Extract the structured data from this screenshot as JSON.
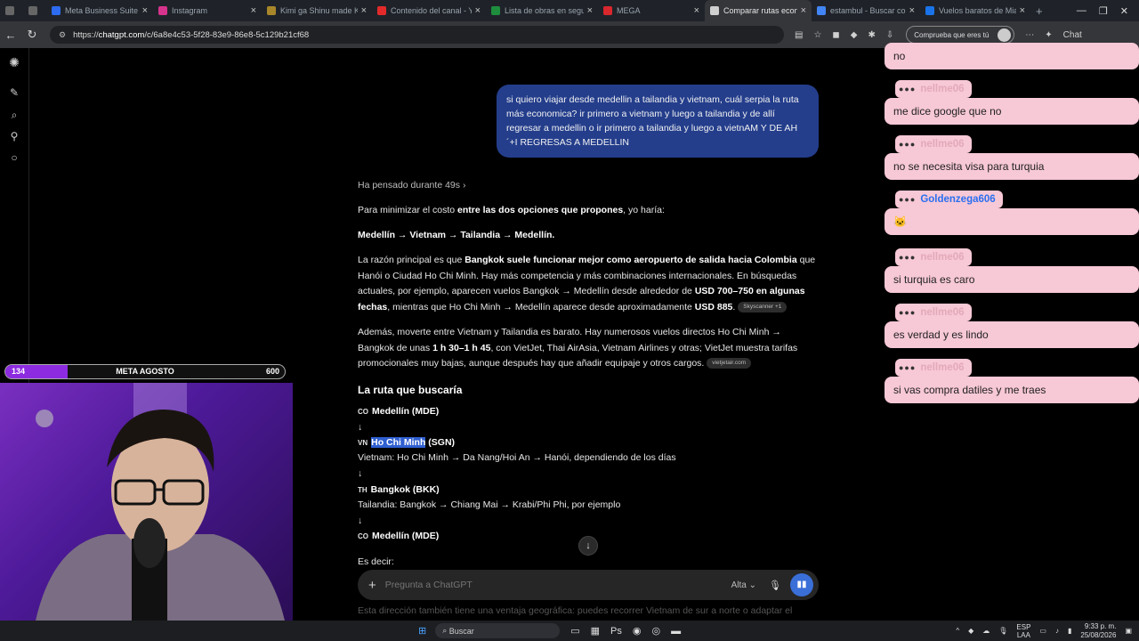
{
  "tabs": [
    {
      "label": "Meta Business Suite",
      "color": "#2d6bf0",
      "active": false
    },
    {
      "label": "Instagram",
      "color": "#d6338d",
      "active": false
    },
    {
      "label": "Kimi ga Shinu made Koi",
      "color": "#a8862a",
      "active": false
    },
    {
      "label": "Contenido del canal - Y",
      "color": "#e22a2a",
      "active": false
    },
    {
      "label": "Lista de obras en segu",
      "color": "#1e8e3e",
      "active": false
    },
    {
      "label": "MEGA",
      "color": "#d9272e",
      "active": false
    },
    {
      "label": "Comparar rutas económ",
      "color": "#cfcfcf",
      "active": true
    },
    {
      "label": "estambul - Buscar con",
      "color": "#4285f4",
      "active": false
    },
    {
      "label": "Vuelos baratos de Mia",
      "color": "#1a73e8",
      "active": false
    }
  ],
  "address": {
    "protocol": "https://",
    "host": "chatgpt.com",
    "path": "/c/6a8e4c53-5f28-83e9-86e8-5c129b21cf68"
  },
  "captcha_label": "Comprueba que eres tú",
  "chat_label": "Chat",
  "user_message": "si quiero viajar desde medellin a tailandia y vietnam, cuál serpia la ruta más economica? ir primero a vietnam y luego a tailandia y de allí regresar a medellin o ir primero a tailandia y luego a vietnAM Y DE AH ´+I REGRESAS A MEDELLIN",
  "thought": "Ha pensado durante 49s",
  "p1_a": "Para minimizar el costo ",
  "p1_b": "entre las dos opciones que propones",
  "p1_c": ", yo haría:",
  "p2": "Medellín → Vietnam → Tailandia → Medellín.",
  "p3_a": "La razón principal es que ",
  "p3_b": "Bangkok suele funcionar mejor como aeropuerto de salida hacia Colombia",
  "p3_c": " que Hanói o Ciudad Ho Chi Minh. Hay más competencia y más combinaciones internacionales. En búsquedas actuales, por ejemplo, aparecen vuelos Bangkok → Medellín desde alrededor de ",
  "p3_d": "USD 700–750 en algunas fechas",
  "p3_e": ", mientras que Ho Chi Minh → Medellín aparece desde aproximadamente ",
  "p3_f": "USD 885",
  "p3_g": ".",
  "src1": "Skyscanner +1",
  "p4_a": "Además, moverte entre Vietnam y Tailandia es barato. Hay numerosos vuelos directos Ho Chi Minh → Bangkok de unas ",
  "p4_b": "1 h 30–1 h 45",
  "p4_c": ", con VietJet, Thai AirAsia, Vietnam Airlines y otras; VietJet muestra tarifas promocionales muy bajas, aunque después hay que añadir equipaje y otros cargos.",
  "src2": "vietjetair.com",
  "heading": "La ruta que buscaría",
  "arrow": "↓",
  "r1_flag": "CO",
  "r1": "Medellín (MDE)",
  "r2_flag": "VN",
  "r2_hl": "Ho Chi Minh",
  "r2_rest": " (SGN)",
  "r2_desc": "Vietnam: Ho Chi Minh → Da Nang/Hoi An → Hanói, dependiendo de los días",
  "r3_flag": "TH",
  "r3": "Bangkok (BKK)",
  "r3_desc": "Tailandia: Bangkok → Chiang Mai → Krabi/Phi Phi, por ejemplo",
  "r4_flag": "CO",
  "r4": "Medellín (MDE)",
  "es_decir": "Es decir:",
  "composer_placeholder": "Pregunta a ChatGPT",
  "model": "Alta",
  "fade_text": "Esta dirección también tiene una ventaja geográfica: puedes recorrer Vietnam de sur a norte o adaptar el",
  "live_chat": [
    {
      "user": "",
      "msg": "no"
    },
    {
      "user": "nellme06",
      "msg": "me dice google que no"
    },
    {
      "user": "nellme06",
      "msg": "no se necesita visa para turquia"
    },
    {
      "user": "Goldenzega606",
      "msg": "🐱"
    },
    {
      "user": "nellme06",
      "msg": "si turquia es caro"
    },
    {
      "user": "nellme06",
      "msg": "es verdad y es lindo"
    },
    {
      "user": "nellme06",
      "msg": "si vas compra datiles y me traes"
    }
  ],
  "meta": {
    "label": "META AGOSTO",
    "current": "134",
    "goal": "600",
    "progress": 0.223
  },
  "taskbar": {
    "search": "Buscar",
    "lang1": "ESP",
    "lang2": "LAA",
    "time": "9:33 p. m.",
    "date": "25/08/2026"
  }
}
